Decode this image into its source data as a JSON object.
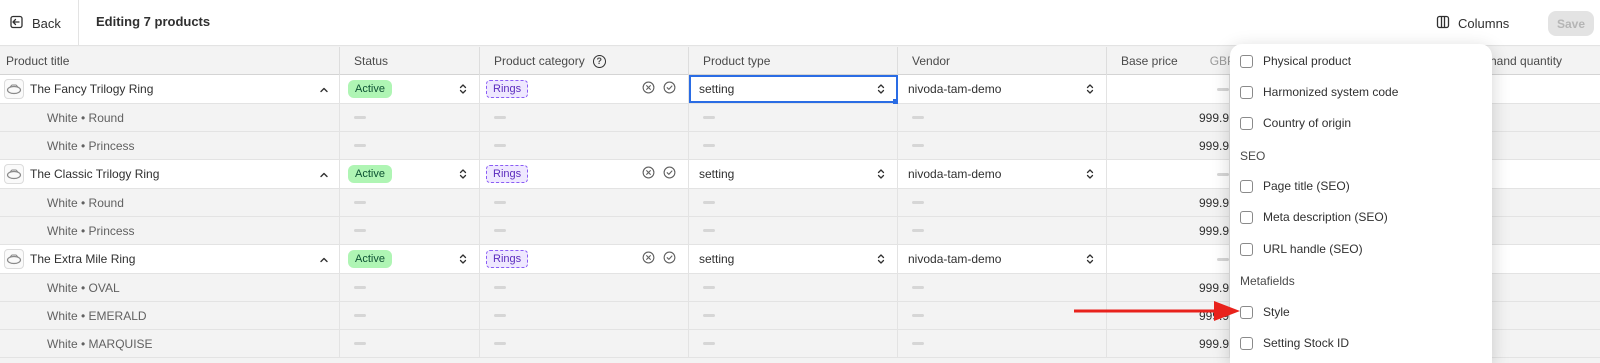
{
  "topbar": {
    "back_label": "Back",
    "title": "Editing 7 products",
    "columns_label": "Columns",
    "save_label": "Save"
  },
  "columns": {
    "product_title": "Product title",
    "status": "Status",
    "product_category": "Product category",
    "product_type": "Product type",
    "vendor": "Vendor",
    "base_price": "Base price",
    "currency": "GBP",
    "on_hand": "hand quantity"
  },
  "products": [
    {
      "title": "The Fancy Trilogy Ring",
      "status": "Active",
      "category": "Rings",
      "type": "setting",
      "vendor": "nivoda-tam-demo",
      "variants": [
        {
          "title": "White • Round",
          "price": "999.9"
        },
        {
          "title": "White • Princess",
          "price": "999.9"
        }
      ]
    },
    {
      "title": "The Classic Trilogy Ring",
      "status": "Active",
      "category": "Rings",
      "type": "setting",
      "vendor": "nivoda-tam-demo",
      "variants": [
        {
          "title": "White • Round",
          "price": "999.9"
        },
        {
          "title": "White • Princess",
          "price": "999.9"
        }
      ]
    },
    {
      "title": "The Extra Mile Ring",
      "status": "Active",
      "category": "Rings",
      "type": "setting",
      "vendor": "nivoda-tam-demo",
      "variants": [
        {
          "title": "White • OVAL",
          "price": "999.9"
        },
        {
          "title": "White • EMERALD",
          "price": "999.9"
        },
        {
          "title": "White • MARQUISE",
          "price": "999.9"
        }
      ]
    }
  ],
  "columns_panel": {
    "options_top": [
      "Physical product",
      "Harmonized system code",
      "Country of origin"
    ],
    "seo_heading": "SEO",
    "seo_options": [
      "Page title (SEO)",
      "Meta description (SEO)",
      "URL handle (SEO)"
    ],
    "metafields_heading": "Metafields",
    "metafield_options": [
      "Style",
      "Setting Stock ID"
    ]
  },
  "colors": {
    "focus": "#2a6ce4",
    "status_bg": "#aff5b4",
    "category_bg": "#efe8ff",
    "arrow": "#e8221c"
  }
}
